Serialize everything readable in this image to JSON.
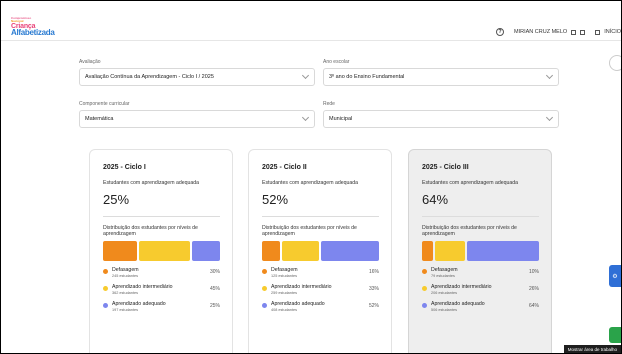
{
  "header": {
    "logo_line1": "Compromisso",
    "logo_line2": "Nacional",
    "logo_line3": "Criança",
    "logo_line4": "Alfabetizada",
    "help_glyph": "?",
    "user_name": "MIRIAN CRUZ MELO",
    "home_label": "INÍCIO"
  },
  "filters": {
    "avaliacao": {
      "label": "Avaliação",
      "value": "Avaliação Contínua da Aprendizagem - Ciclo I / 2025"
    },
    "ano": {
      "label": "Ano escolar",
      "value": "3º ano do Ensino Fundamental"
    },
    "componente": {
      "label": "Componente curricular",
      "value": "Matemática"
    },
    "rede": {
      "label": "Rede",
      "value": "Municipal"
    }
  },
  "colors": {
    "defasagem": "#f08a1c",
    "intermediario": "#f7cb2e",
    "adequado": "#7d86ee"
  },
  "cards": [
    {
      "title": "2025 - Ciclo I",
      "subtitle": "Estudantes com aprendizagem adequada",
      "percent": "25%",
      "dist_label": "Distribuição dos estudantes por níveis de aprendizagem",
      "bar": [
        0.3,
        0.45,
        0.25
      ],
      "levels": [
        {
          "name": "Defasagem",
          "count": "245 estudantes",
          "pct": "30%"
        },
        {
          "name": "Aprendizado intermediário",
          "count": "362 estudantes",
          "pct": "45%"
        },
        {
          "name": "Aprendizado adequado",
          "count": "197 estudantes",
          "pct": "25%"
        }
      ]
    },
    {
      "title": "2025 - Ciclo II",
      "subtitle": "Estudantes com aprendizagem adequada",
      "percent": "52%",
      "dist_label": "Distribuição dos estudantes por níveis de aprendizagem",
      "bar": [
        0.16,
        0.33,
        0.52
      ],
      "levels": [
        {
          "name": "Defasagem",
          "count": "125 estudantes",
          "pct": "16%"
        },
        {
          "name": "Aprendizado intermediário",
          "count": "259 estudantes",
          "pct": "33%"
        },
        {
          "name": "Aprendizado adequado",
          "count": "408 estudantes",
          "pct": "52%"
        }
      ]
    },
    {
      "title": "2025 - Ciclo III",
      "subtitle": "Estudantes com aprendizagem adequada",
      "percent": "64%",
      "dist_label": "Distribuição dos estudantes por níveis de aprendizagem",
      "bar": [
        0.1,
        0.26,
        0.64
      ],
      "levels": [
        {
          "name": "Defasagem",
          "count": "79 estudantes",
          "pct": "10%"
        },
        {
          "name": "Aprendizado intermediário",
          "count": "206 estudantes",
          "pct": "26%"
        },
        {
          "name": "Aprendizado adequado",
          "count": "506 estudantes",
          "pct": "64%"
        }
      ]
    }
  ],
  "tooltip": "Mostrar área de trabalho"
}
